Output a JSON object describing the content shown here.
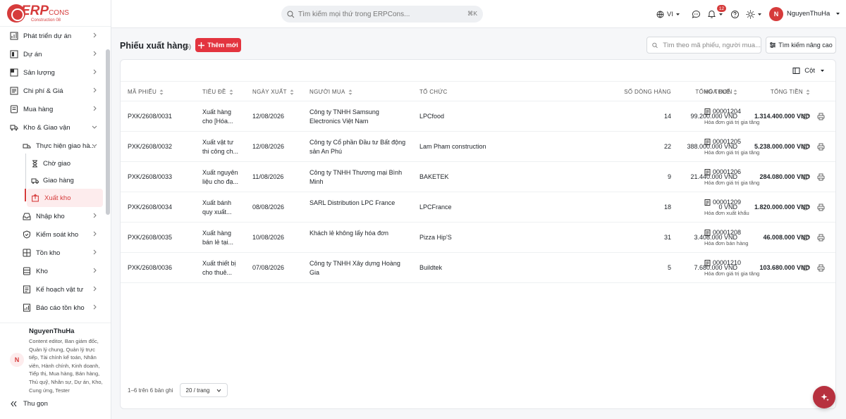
{
  "app": {
    "logo_erp": "ERP",
    "logo_cons": "CONS",
    "logo_sub": "Construction 08"
  },
  "sidebar": {
    "items": [
      {
        "label": "Phát triển dự án",
        "icon": "project-growth-icon"
      },
      {
        "label": "Dự án",
        "icon": "project-icon"
      },
      {
        "label": "Sản lượng",
        "icon": "output-icon"
      },
      {
        "label": "Chi phí & Giá",
        "icon": "cost-icon"
      },
      {
        "label": "Mua hàng",
        "icon": "purchase-icon"
      },
      {
        "label": "Kho & Giao vận",
        "icon": "warehouse-truck-icon"
      }
    ],
    "sub_group": {
      "label": "Thực hiện giao hà...",
      "icon": "delivery-execution-icon"
    },
    "sub2": [
      {
        "label": "Chờ giao",
        "icon": "hourglass-icon"
      },
      {
        "label": "Giao hàng",
        "icon": "truck-icon"
      },
      {
        "label": "Xuất kho",
        "icon": "box-export-icon"
      }
    ],
    "more": [
      {
        "label": "Nhập kho",
        "icon": "inbox-icon"
      },
      {
        "label": "Kiểm soát kho",
        "icon": "shield-icon"
      },
      {
        "label": "Tồn kho",
        "icon": "stock-icon"
      },
      {
        "label": "Kho",
        "icon": "storage-icon"
      },
      {
        "label": "Kế hoạch vật tư",
        "icon": "plan-icon"
      },
      {
        "label": "Báo cáo tồn kho",
        "icon": "report-icon"
      }
    ],
    "user": {
      "name": "NguyenThuHa",
      "initial": "N",
      "roles": "Content editor, Ban giám đốc, Quản lý chung, Quản lý trực tiếp, Tài chính kế toán, Nhân viên, Hành chính, Kinh doanh, Tiếp thị, Mua hàng, Bán hàng, Thủ quỹ, Nhân sự, Dự án, Kho, Cung ứng, Tester"
    },
    "collapse_label": "Thu gọn"
  },
  "topbar": {
    "search_placeholder": "Tìm kiếm mọi thứ trong ERPCons...",
    "shortcut": "⌘K",
    "language": "VI",
    "notification_count": "12",
    "username": "NguyenThuHa",
    "user_initial": "N"
  },
  "page": {
    "title": "Phiếu xuất hàng",
    "count": "(6)",
    "add_label": "Thêm mới",
    "search_placeholder": "Tìm theo mã phiếu, người mua...",
    "advanced_search": "Tìm kiếm nâng cao",
    "columns_label": "Cột"
  },
  "table": {
    "headers": {
      "code": "MÃ PHIẾU",
      "title": "TIÊU ĐỀ",
      "date": "NGÀY XUẤT",
      "buyer": "NGƯỜI MUA",
      "org": "TỔ CHỨC",
      "lines": "SỐ DÒNG HÀNG",
      "tax": "TỔNG THUẾ",
      "total": "TỔNG TIỀN",
      "invoice": "HÓA ĐƠN"
    },
    "rows": [
      {
        "code": "PXK/2608/0031",
        "title": "Xuất hàng cho [Hóa...",
        "date": "12/08/2026",
        "buyer": "Công ty TNHH Samsung Electronics Việt Nam",
        "org": "LPCfood",
        "lines": "14",
        "tax": "99.200.000 VND",
        "total": "1.314.400.000 VND",
        "invoice": "00001204",
        "invoice_type": "Hóa đơn giá trị gia tăng"
      },
      {
        "code": "PXK/2608/0032",
        "title": "Xuất vật tư thi công ch...",
        "date": "12/08/2026",
        "buyer": "Công ty Cổ phần Đầu tư Bất động sản An Phú",
        "org": "Lam Pham construction",
        "lines": "22",
        "tax": "388.000.000 VND",
        "total": "5.238.000.000 VND",
        "invoice": "00001205",
        "invoice_type": "Hóa đơn giá trị gia tăng"
      },
      {
        "code": "PXK/2608/0033",
        "title": "Xuất nguyên liệu cho đạ...",
        "date": "11/08/2026",
        "buyer": "Công ty TNHH Thương mại Bình Minh",
        "org": "BAKETEK",
        "lines": "9",
        "tax": "21.440.000 VND",
        "total": "284.080.000 VND",
        "invoice": "00001206",
        "invoice_type": "Hóa đơn giá trị gia tăng"
      },
      {
        "code": "PXK/2608/0034",
        "title": "Xuất bánh quy xuất...",
        "date": "08/08/2026",
        "buyer": "SARL Distribution LPC France",
        "org": "LPCFrance",
        "lines": "18",
        "tax": "0 VND",
        "total": "1.820.000.000 VND",
        "invoice": "00001209",
        "invoice_type": "Hóa đơn xuất khẩu"
      },
      {
        "code": "PXK/2608/0035",
        "title": "Xuất hàng bán lẻ tại...",
        "date": "10/08/2026",
        "buyer": "Khách lẻ không lấy hóa đơn",
        "org": "Pizza Hip'S",
        "lines": "31",
        "tax": "3.408.000 VND",
        "total": "46.008.000 VND",
        "invoice": "00001208",
        "invoice_type": "Hóa đơn bán hàng"
      },
      {
        "code": "PXK/2608/0036",
        "title": "Xuất thiết bị cho thuê...",
        "date": "07/08/2026",
        "buyer": "Công ty TNHH Xây dựng Hoàng Gia",
        "org": "Buildtek",
        "lines": "5",
        "tax": "7.680.000 VND",
        "total": "103.680.000 VND",
        "invoice": "00001210",
        "invoice_type": "Hóa đơn giá trị gia tăng"
      }
    ]
  },
  "pagination": {
    "summary": "1–6 trên 6 bản ghi",
    "page_size": "20 / trang"
  },
  "colors": {
    "accent": "#d63b3b",
    "button": "#e3343f",
    "fab": "#b7313f"
  }
}
